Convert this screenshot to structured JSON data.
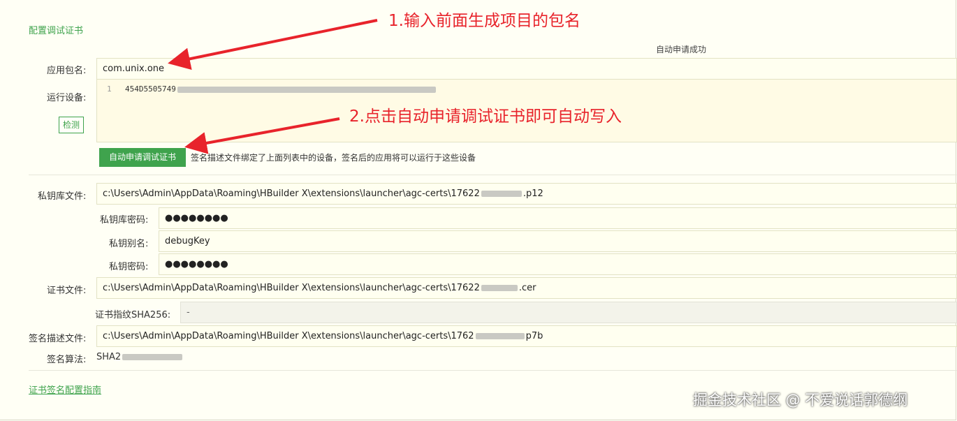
{
  "section_title": "配置调试证书",
  "status_text": "自动申请成功",
  "package_name": {
    "label": "应用包名:",
    "value": "com.unix.one"
  },
  "devices": {
    "label": "运行设备:",
    "line_number": "1",
    "code_visible": "454D5505749",
    "detect_button": "检测"
  },
  "auto_apply": {
    "button": "自动申请调试证书",
    "hint": "签名描述文件绑定了上面列表中的设备，签名后的应用将可以运行于这些设备"
  },
  "keystore_file": {
    "label": "私钥库文件:",
    "value": "c:\\Users\\Admin\\AppData\\Roaming\\HBuilder X\\extensions\\launcher\\agc-certs\\17622",
    "suffix": ".p12"
  },
  "keystore_password": {
    "label": "私钥库密码:",
    "value": "●●●●●●●●"
  },
  "key_alias": {
    "label": "私钥别名:",
    "value": "debugKey"
  },
  "key_password": {
    "label": "私钥密码:",
    "value": "●●●●●●●●"
  },
  "cert_file": {
    "label": "证书文件:",
    "value": "c:\\Users\\Admin\\AppData\\Roaming\\HBuilder X\\extensions\\launcher\\agc-certs\\17622",
    "suffix": ".cer"
  },
  "cert_fingerprint": {
    "label": "证书指纹SHA256:",
    "value": "-"
  },
  "profile_file": {
    "label": "签名描述文件:",
    "value": "c:\\Users\\Admin\\AppData\\Roaming\\HBuilder X\\extensions\\launcher\\agc-certs\\1762",
    "suffix": "p7b"
  },
  "sign_algorithm": {
    "label": "签名算法:",
    "value": "SHA2"
  },
  "guide_link": "证书签名配置指南",
  "annotations": {
    "step1": "1.输入前面生成项目的包名",
    "step2": "2.点击自动申请调试证书即可自动写入",
    "color": "#e8232b"
  },
  "watermark": "掘金技术社区 @ 不爱说话郭德纲",
  "colors": {
    "accent": "#3fa34d",
    "background": "#fffff5"
  }
}
